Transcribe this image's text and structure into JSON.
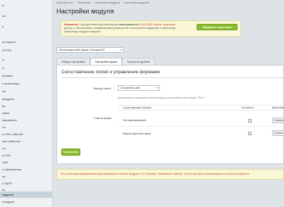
{
  "sidebar": {
    "items": [
      {
        "label": "ы"
      },
      {
        "label": "ия"
      },
      {
        "label": "и"
      },
      {
        "label": "ая защита"
      },
      {
        "label": "HTTPS"
      },
      {
        "label": "ы"
      },
      {
        "label": "ы"
      },
      {
        "label": "Битрикс"
      },
      {
        "label": "и хранилища"
      },
      {
        "label": "зы"
      },
      {
        "label": "продукта"
      },
      {
        "label": "ии"
      },
      {
        "label": "сайта"
      },
      {
        "label": "параметры"
      },
      {
        "label": "ты"
      },
      {
        "label": "и СМС событий"
      },
      {
        "label": "ные шаблоны"
      },
      {
        "label": "ля"
      },
      {
        "label": "и СМС"
      },
      {
        "label": "СМС"
      },
      {
        "label": "и оформления"
      },
      {
        "label": "ия"
      },
      {
        "label": "и SMTP"
      },
      {
        "label": "ия"
      },
      {
        "label": "модулей"
      },
      {
        "label": "и модуля"
      },
      {
        "label": "ые модули"
      }
    ],
    "active_index": 25
  },
  "breadcrumbs": [
    "Рабочий стол",
    "Настройки",
    "Настройки продукта",
    "Настройки модулей"
  ],
  "page_title": "Настройки модуля",
  "notice": {
    "strong": "Внимание!",
    "text_1": "Срок действия пробной версии",
    "expires_label": "заканчивается",
    "text_2": "23.04.2025.",
    "link": "Купить лицензию",
    "text_3": "Доступ к обновлениям, исправлениям уязвимостей, технической поддержке и ",
    "text_4": "облачному хранилищу продукта закроют.",
    "button": "Продлить лицензию"
  },
  "form_select": "Интеграция веб форм с Битрикс24",
  "tabs": [
    {
      "label": "Общие настройки"
    },
    {
      "label": "Настройка форм"
    },
    {
      "label": "Контроль дублей"
    }
  ],
  "active_tab": 1,
  "section_title": "Сопоставление полей и управление формами",
  "site_label": "Выбор сайта:",
  "site_value": "Основной сайт",
  "hint": "Применимо по умолчанию для всех форм установлен тип данных \"Лид\"",
  "forms_label": "Список форм:",
  "table_headers": [
    "Существующие формы",
    "Активные",
    "Действия"
  ],
  "rows": [
    {
      "name": "Тестовая форма#4",
      "action": "Сопоставить"
    },
    {
      "name": "Форма обратной связи",
      "action": "Сопоставить"
    }
  ],
  "save_button": "Сохранить",
  "footer": "Эта установка предназначена для разработки на базе продукта \"1С-Битрикс: Управление сайтом\". Она не должна использоваться в качестве рабочего"
}
